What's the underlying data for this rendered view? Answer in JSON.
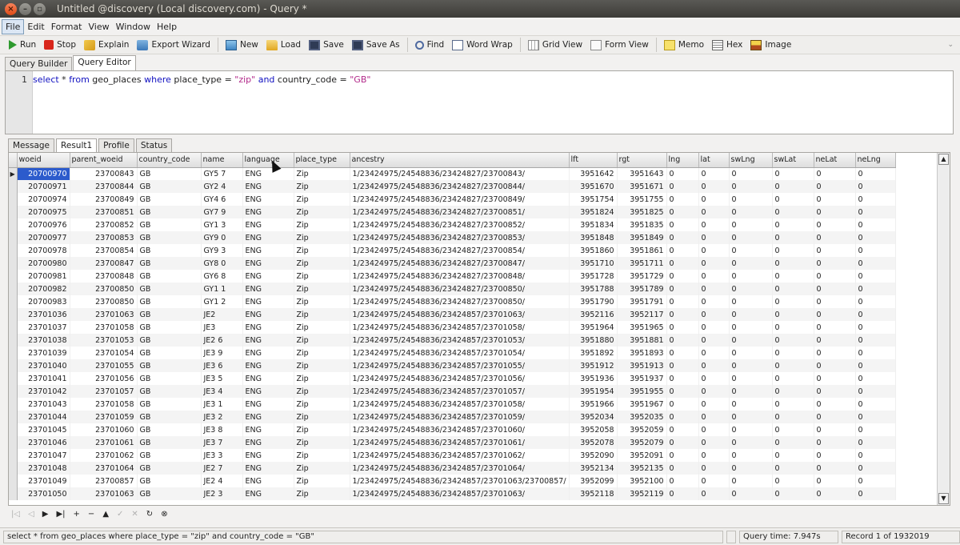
{
  "window": {
    "title": "Untitled @discovery (Local discovery.com) - Query *"
  },
  "menu": [
    "File",
    "Edit",
    "Format",
    "View",
    "Window",
    "Help"
  ],
  "toolbar": {
    "run": "Run",
    "stop": "Stop",
    "explain": "Explain",
    "export": "Export Wizard",
    "new": "New",
    "load": "Load",
    "save": "Save",
    "save_as": "Save As",
    "find": "Find",
    "word_wrap": "Word Wrap",
    "grid_view": "Grid View",
    "form_view": "Form View",
    "memo": "Memo",
    "hex": "Hex",
    "image": "Image"
  },
  "query_tabs": [
    "Query Builder",
    "Query Editor"
  ],
  "editor": {
    "line_number": "1",
    "sql": {
      "kw1": "select",
      "t1": " * ",
      "kw2": "from",
      "t2": " geo_places ",
      "kw3": "where",
      "t3": " place_type = ",
      "s1": "\"zip\"",
      "t4": " ",
      "kw4": "and",
      "t5": " country_code = ",
      "s2": "\"GB\""
    }
  },
  "result_tabs": [
    "Message",
    "Result1",
    "Profile",
    "Status"
  ],
  "columns": [
    "woeid",
    "parent_woeid",
    "country_code",
    "name",
    "language",
    "place_type",
    "ancestry",
    "lft",
    "rgt",
    "lng",
    "lat",
    "swLng",
    "swLat",
    "neLat",
    "neLng"
  ],
  "rows": [
    [
      "20700970",
      "23700843",
      "GB",
      "GY5 7",
      "ENG",
      "Zip",
      "1/23424975/24548836/23424827/23700843/",
      "3951642",
      "3951643",
      "0",
      "0",
      "0",
      "0",
      "0",
      "0"
    ],
    [
      "20700971",
      "23700844",
      "GB",
      "GY2 4",
      "ENG",
      "Zip",
      "1/23424975/24548836/23424827/23700844/",
      "3951670",
      "3951671",
      "0",
      "0",
      "0",
      "0",
      "0",
      "0"
    ],
    [
      "20700974",
      "23700849",
      "GB",
      "GY4 6",
      "ENG",
      "Zip",
      "1/23424975/24548836/23424827/23700849/",
      "3951754",
      "3951755",
      "0",
      "0",
      "0",
      "0",
      "0",
      "0"
    ],
    [
      "20700975",
      "23700851",
      "GB",
      "GY7 9",
      "ENG",
      "Zip",
      "1/23424975/24548836/23424827/23700851/",
      "3951824",
      "3951825",
      "0",
      "0",
      "0",
      "0",
      "0",
      "0"
    ],
    [
      "20700976",
      "23700852",
      "GB",
      "GY1 3",
      "ENG",
      "Zip",
      "1/23424975/24548836/23424827/23700852/",
      "3951834",
      "3951835",
      "0",
      "0",
      "0",
      "0",
      "0",
      "0"
    ],
    [
      "20700977",
      "23700853",
      "GB",
      "GY9 0",
      "ENG",
      "Zip",
      "1/23424975/24548836/23424827/23700853/",
      "3951848",
      "3951849",
      "0",
      "0",
      "0",
      "0",
      "0",
      "0"
    ],
    [
      "20700978",
      "23700854",
      "GB",
      "GY9 3",
      "ENG",
      "Zip",
      "1/23424975/24548836/23424827/23700854/",
      "3951860",
      "3951861",
      "0",
      "0",
      "0",
      "0",
      "0",
      "0"
    ],
    [
      "20700980",
      "23700847",
      "GB",
      "GY8 0",
      "ENG",
      "Zip",
      "1/23424975/24548836/23424827/23700847/",
      "3951710",
      "3951711",
      "0",
      "0",
      "0",
      "0",
      "0",
      "0"
    ],
    [
      "20700981",
      "23700848",
      "GB",
      "GY6 8",
      "ENG",
      "Zip",
      "1/23424975/24548836/23424827/23700848/",
      "3951728",
      "3951729",
      "0",
      "0",
      "0",
      "0",
      "0",
      "0"
    ],
    [
      "20700982",
      "23700850",
      "GB",
      "GY1 1",
      "ENG",
      "Zip",
      "1/23424975/24548836/23424827/23700850/",
      "3951788",
      "3951789",
      "0",
      "0",
      "0",
      "0",
      "0",
      "0"
    ],
    [
      "20700983",
      "23700850",
      "GB",
      "GY1 2",
      "ENG",
      "Zip",
      "1/23424975/24548836/23424827/23700850/",
      "3951790",
      "3951791",
      "0",
      "0",
      "0",
      "0",
      "0",
      "0"
    ],
    [
      "23701036",
      "23701063",
      "GB",
      "JE2",
      "ENG",
      "Zip",
      "1/23424975/24548836/23424857/23701063/",
      "3952116",
      "3952117",
      "0",
      "0",
      "0",
      "0",
      "0",
      "0"
    ],
    [
      "23701037",
      "23701058",
      "GB",
      "JE3",
      "ENG",
      "Zip",
      "1/23424975/24548836/23424857/23701058/",
      "3951964",
      "3951965",
      "0",
      "0",
      "0",
      "0",
      "0",
      "0"
    ],
    [
      "23701038",
      "23701053",
      "GB",
      "JE2 6",
      "ENG",
      "Zip",
      "1/23424975/24548836/23424857/23701053/",
      "3951880",
      "3951881",
      "0",
      "0",
      "0",
      "0",
      "0",
      "0"
    ],
    [
      "23701039",
      "23701054",
      "GB",
      "JE3 9",
      "ENG",
      "Zip",
      "1/23424975/24548836/23424857/23701054/",
      "3951892",
      "3951893",
      "0",
      "0",
      "0",
      "0",
      "0",
      "0"
    ],
    [
      "23701040",
      "23701055",
      "GB",
      "JE3 6",
      "ENG",
      "Zip",
      "1/23424975/24548836/23424857/23701055/",
      "3951912",
      "3951913",
      "0",
      "0",
      "0",
      "0",
      "0",
      "0"
    ],
    [
      "23701041",
      "23701056",
      "GB",
      "JE3 5",
      "ENG",
      "Zip",
      "1/23424975/24548836/23424857/23701056/",
      "3951936",
      "3951937",
      "0",
      "0",
      "0",
      "0",
      "0",
      "0"
    ],
    [
      "23701042",
      "23701057",
      "GB",
      "JE3 4",
      "ENG",
      "Zip",
      "1/23424975/24548836/23424857/23701057/",
      "3951954",
      "3951955",
      "0",
      "0",
      "0",
      "0",
      "0",
      "0"
    ],
    [
      "23701043",
      "23701058",
      "GB",
      "JE3 1",
      "ENG",
      "Zip",
      "1/23424975/24548836/23424857/23701058/",
      "3951966",
      "3951967",
      "0",
      "0",
      "0",
      "0",
      "0",
      "0"
    ],
    [
      "23701044",
      "23701059",
      "GB",
      "JE3 2",
      "ENG",
      "Zip",
      "1/23424975/24548836/23424857/23701059/",
      "3952034",
      "3952035",
      "0",
      "0",
      "0",
      "0",
      "0",
      "0"
    ],
    [
      "23701045",
      "23701060",
      "GB",
      "JE3 8",
      "ENG",
      "Zip",
      "1/23424975/24548836/23424857/23701060/",
      "3952058",
      "3952059",
      "0",
      "0",
      "0",
      "0",
      "0",
      "0"
    ],
    [
      "23701046",
      "23701061",
      "GB",
      "JE3 7",
      "ENG",
      "Zip",
      "1/23424975/24548836/23424857/23701061/",
      "3952078",
      "3952079",
      "0",
      "0",
      "0",
      "0",
      "0",
      "0"
    ],
    [
      "23701047",
      "23701062",
      "GB",
      "JE3 3",
      "ENG",
      "Zip",
      "1/23424975/24548836/23424857/23701062/",
      "3952090",
      "3952091",
      "0",
      "0",
      "0",
      "0",
      "0",
      "0"
    ],
    [
      "23701048",
      "23701064",
      "GB",
      "JE2 7",
      "ENG",
      "Zip",
      "1/23424975/24548836/23424857/23701064/",
      "3952134",
      "3952135",
      "0",
      "0",
      "0",
      "0",
      "0",
      "0"
    ],
    [
      "23701049",
      "23700857",
      "GB",
      "JE2 4",
      "ENG",
      "Zip",
      "1/23424975/24548836/23424857/23701063/23700857/",
      "3952099",
      "3952100",
      "0",
      "0",
      "0",
      "0",
      "0",
      "0"
    ],
    [
      "23701050",
      "23701063",
      "GB",
      "JE2 3",
      "ENG",
      "Zip",
      "1/23424975/24548836/23424857/23701063/",
      "3952118",
      "3952119",
      "0",
      "0",
      "0",
      "0",
      "0",
      "0"
    ]
  ],
  "nav": [
    "|◁",
    "◁",
    "▶",
    "▶|",
    "+",
    "−",
    "▲",
    "✓",
    "✕",
    "↻",
    "⊗"
  ],
  "status": {
    "sql": "select * from geo_places where place_type = \"zip\" and country_code = \"GB\"",
    "query_time": "Query time: 7.947s",
    "record": "Record 1 of 1932019"
  },
  "colors": {
    "selection": "#2c5bcc",
    "title_bar": "#3c3b37",
    "close_button": "#df4a16"
  }
}
